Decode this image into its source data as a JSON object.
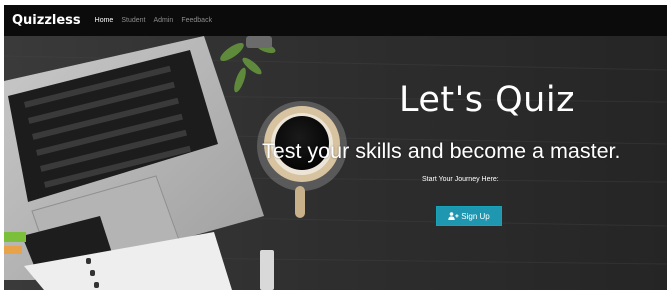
{
  "navbar": {
    "brand": "Quizzless",
    "links": [
      {
        "label": "Home",
        "active": true
      },
      {
        "label": "Student",
        "active": false
      },
      {
        "label": "Admin",
        "active": false
      },
      {
        "label": "Feedback",
        "active": false
      }
    ]
  },
  "hero": {
    "title": "Let's Quiz",
    "subtitle": "Test your skills and become a master.",
    "lead": "Start Your Journey Here:",
    "signup_label": "Sign Up",
    "signup_icon": "user-plus-icon"
  },
  "colors": {
    "navbar": "#0b0b0b",
    "button": "#1f97b1",
    "text": "#ffffff",
    "table": "#2b2b2b"
  }
}
